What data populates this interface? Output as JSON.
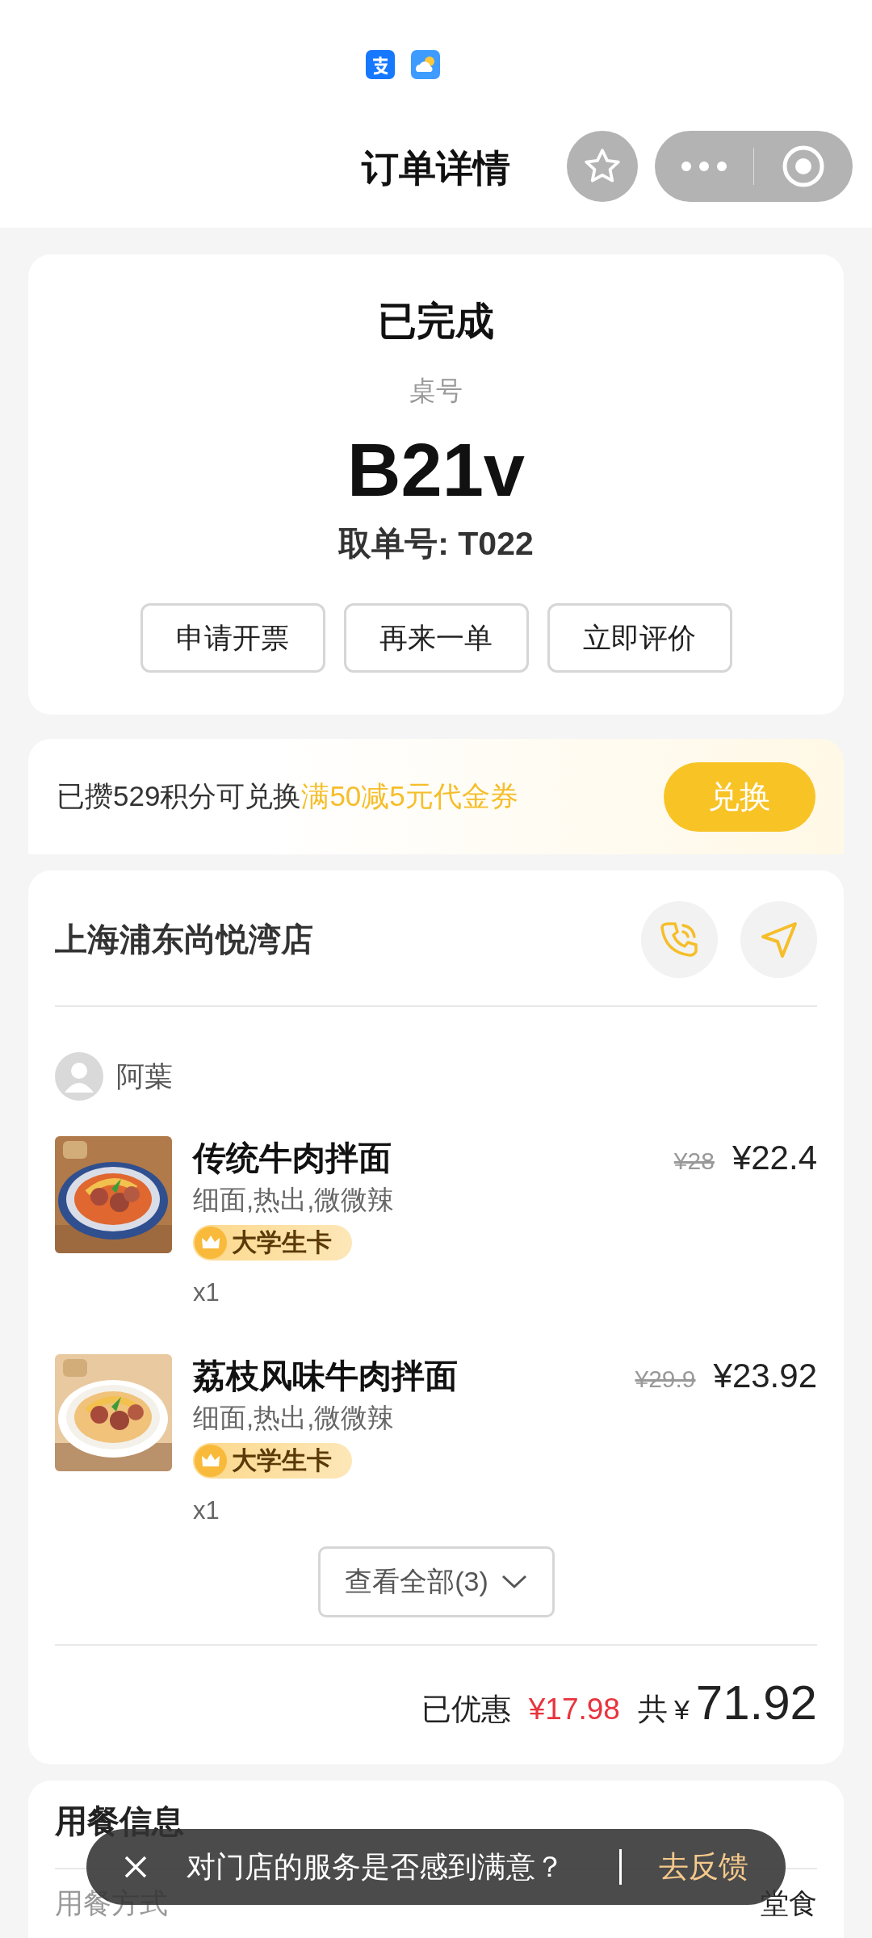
{
  "nav": {
    "title": "订单详情"
  },
  "order": {
    "status": "已完成",
    "table_label": "桌号",
    "table_no": "B21v",
    "pickup": "取单号: T022",
    "actions": [
      "申请开票",
      "再来一单",
      "立即评价"
    ]
  },
  "points": {
    "text": "已攒529积分可兑换",
    "highlight": "满50减5元代金券",
    "button": "兑换"
  },
  "store": {
    "name": "上海浦东尚悦湾店",
    "user": "阿葉",
    "items": [
      {
        "name": "传统牛肉拌面",
        "specs": "细面,热出,微微辣",
        "badge": "大学生卡",
        "original_price": "¥28",
        "price": "¥22.4",
        "quantity": "x1"
      },
      {
        "name": "荔枝风味牛肉拌面",
        "specs": "细面,热出,微微辣",
        "badge": "大学生卡",
        "original_price": "¥29.9",
        "price": "¥23.92",
        "quantity": "x1"
      }
    ],
    "view_all": "查看全部(3)",
    "discount_label": "已优惠",
    "discount": "¥17.98",
    "total_label": "共",
    "total_currency": "¥",
    "total": "71.92"
  },
  "dining_info": {
    "title": "用餐信息",
    "rows": [
      {
        "label": "用餐方式",
        "value": "堂食"
      }
    ]
  },
  "toast": {
    "message": "对门店的服务是否感到满意？",
    "action": "去反馈"
  }
}
